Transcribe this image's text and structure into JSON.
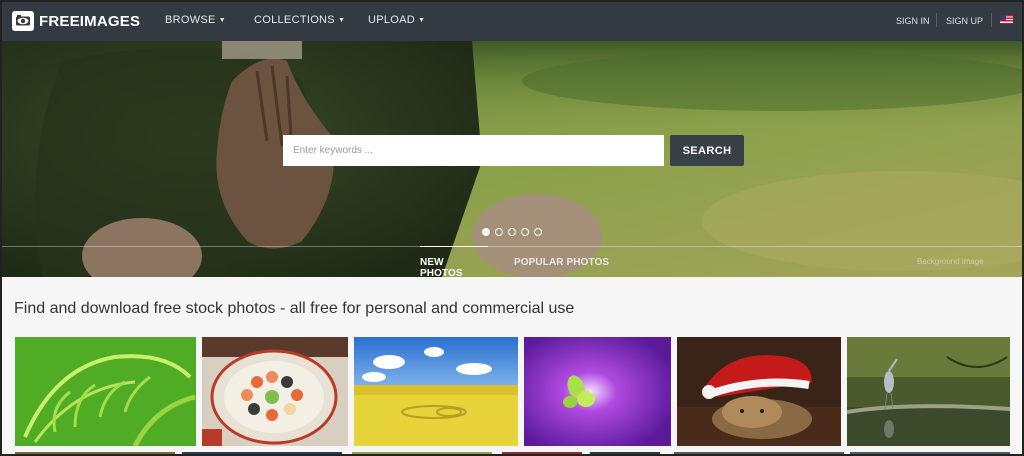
{
  "nav": {
    "logo_text": "FREEIMAGES",
    "menus": [
      "BROWSE",
      "COLLECTIONS",
      "UPLOAD"
    ],
    "sign_in": "SIGN IN",
    "sign_up": "SIGN UP",
    "icons": {
      "logo": "camera-eye-icon",
      "caret": "caret-down-icon",
      "language": "us-flag-icon"
    }
  },
  "hero": {
    "search_placeholder": "Enter keywords ...",
    "search_button": "SEARCH",
    "slides_count": 5,
    "active_slide": 1,
    "tabs": [
      "NEW PHOTOS",
      "POPULAR PHOTOS"
    ],
    "background_credit": "Background image"
  },
  "main": {
    "headline": "Find and download free stock photos - all free for personal and commercial use",
    "photos": [
      "fern-photo",
      "sushi-platter-photo",
      "rapeseed-field-photo",
      "purple-flower-photo",
      "puppy-santa-hat-photo",
      "heron-photo"
    ]
  },
  "colors": {
    "nav_bg": "#343a41",
    "search_button_bg": "#3a4048",
    "page_bg": "#f6f6f6"
  }
}
